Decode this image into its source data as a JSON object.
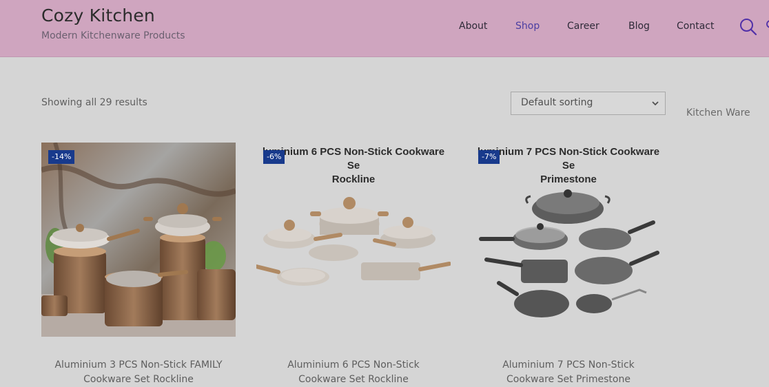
{
  "header": {
    "site_title": "Cozy Kitchen",
    "tagline": "Modern Kitchenware Products",
    "nav": [
      {
        "label": "About"
      },
      {
        "label": "Shop",
        "active": true
      },
      {
        "label": "Career"
      },
      {
        "label": "Blog"
      },
      {
        "label": "Contact"
      }
    ],
    "search_icon": "search-icon"
  },
  "shop": {
    "results_text": "Showing all 29 results",
    "sorting": {
      "selected": "Default sorting"
    },
    "sidebar_heading": "Kitchen Ware",
    "products": [
      {
        "badge": "-14%",
        "title_line1": "Aluminium 3 PCS Non-Stick FAMILY",
        "title_line2": "Cookware Set Rockline"
      },
      {
        "badge": "-6%",
        "image_caption_line1": "luminium 6 PCS Non-Stick Cookware Se",
        "image_caption_line2": "Rockline",
        "title_line1": "Aluminium 6 PCS Non-Stick",
        "title_line2": "Cookware Set Rockline"
      },
      {
        "badge": "-7%",
        "image_caption_line1": "luminium 7 PCS Non-Stick Cookware Se",
        "image_caption_line2": "Primestone",
        "title_line1": "Aluminium 7 PCS Non-Stick",
        "title_line2": "Cookware Set Primestone"
      }
    ]
  },
  "colors": {
    "header_bg": "#cfa5bf",
    "page_bg": "#d5d5d5",
    "active_nav": "#4b3ea2",
    "badge_bg": "#183a8c"
  }
}
